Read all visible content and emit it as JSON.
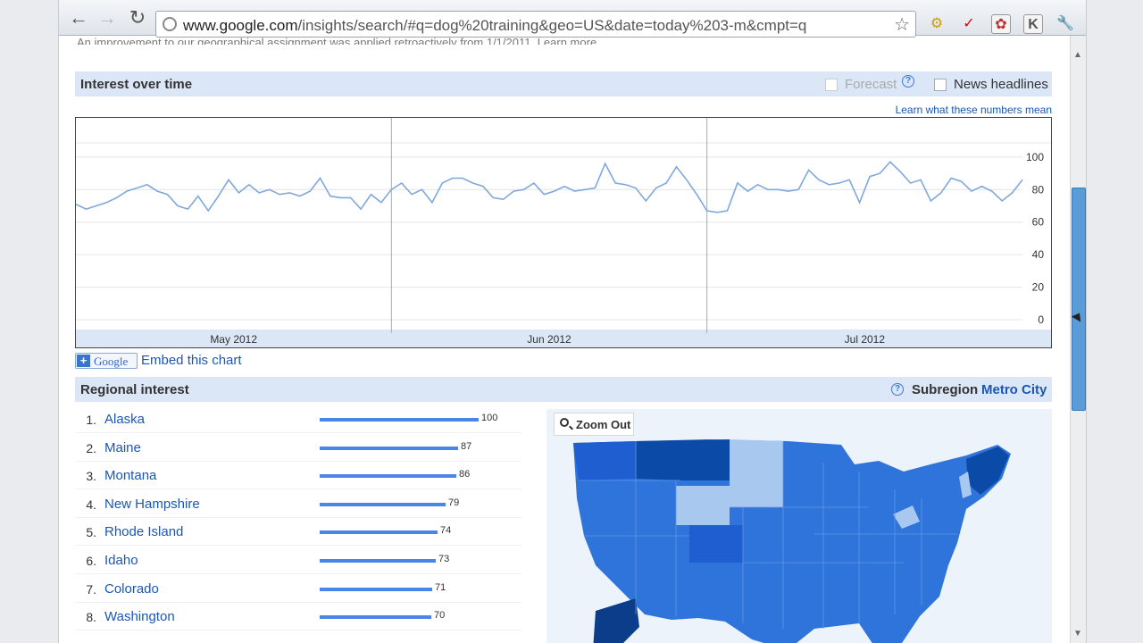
{
  "browser": {
    "url_host": "www.google.com",
    "url_path": "/insights/search/#q=dog%20training&geo=US&date=today%203-m&cmpt=q"
  },
  "notice": "An improvement to our geographical assignment was applied retroactively from 1/1/2011. Learn more",
  "interest": {
    "title": "Interest over time",
    "forecast_label": "Forecast",
    "news_label": "News headlines",
    "learn_link": "Learn what these numbers mean",
    "embed_link": "Embed this chart",
    "google_button": "Google"
  },
  "chart_data": {
    "type": "line",
    "title": "Interest over time",
    "x_labels": [
      "May 2012",
      "Jun 2012",
      "Jul 2012"
    ],
    "y_ticks": [
      "100",
      "80",
      "60",
      "40",
      "20",
      "0"
    ],
    "ylim": [
      0,
      100
    ],
    "grid": true,
    "series": [
      {
        "values": [
          71,
          68,
          70,
          72,
          75,
          79,
          81,
          83,
          79,
          77,
          70,
          68,
          76,
          67,
          76,
          86,
          78,
          83,
          78,
          80,
          77,
          78,
          76,
          79,
          87,
          76,
          75,
          75,
          68,
          77,
          72,
          80,
          84,
          77,
          80,
          72,
          84,
          87,
          87,
          84,
          82,
          75,
          74,
          79,
          80,
          84,
          77,
          79,
          82,
          79,
          80,
          81,
          96,
          84,
          83,
          81,
          73,
          81,
          84,
          94,
          86,
          77,
          67,
          66,
          67,
          84,
          79,
          83,
          80,
          80,
          79,
          80,
          92,
          86,
          83,
          84,
          86,
          72,
          88,
          90,
          97,
          91,
          84,
          86,
          73,
          78,
          87,
          85,
          79,
          82,
          79,
          73,
          78,
          86
        ]
      }
    ]
  },
  "regional": {
    "title": "Regional interest",
    "subregion_label": "Subregion",
    "subregion_link": "Metro City",
    "zoom_label": "Zoom Out",
    "items": [
      {
        "rank": "1.",
        "name": "Alaska",
        "value": 100
      },
      {
        "rank": "2.",
        "name": "Maine",
        "value": 87
      },
      {
        "rank": "3.",
        "name": "Montana",
        "value": 86
      },
      {
        "rank": "4.",
        "name": "New Hampshire",
        "value": 79
      },
      {
        "rank": "5.",
        "name": "Rhode Island",
        "value": 74
      },
      {
        "rank": "6.",
        "name": "Idaho",
        "value": 73
      },
      {
        "rank": "7.",
        "name": "Colorado",
        "value": 71
      },
      {
        "rank": "8.",
        "name": "Washington",
        "value": 70
      }
    ]
  },
  "colors": {
    "accent": "#4a86e8",
    "link": "#1a57b5",
    "section_bg": "#dbe7f7",
    "map_dark": "#0b4aa6",
    "map_mid": "#2a6fd6",
    "map_light": "#a8c8f0"
  }
}
